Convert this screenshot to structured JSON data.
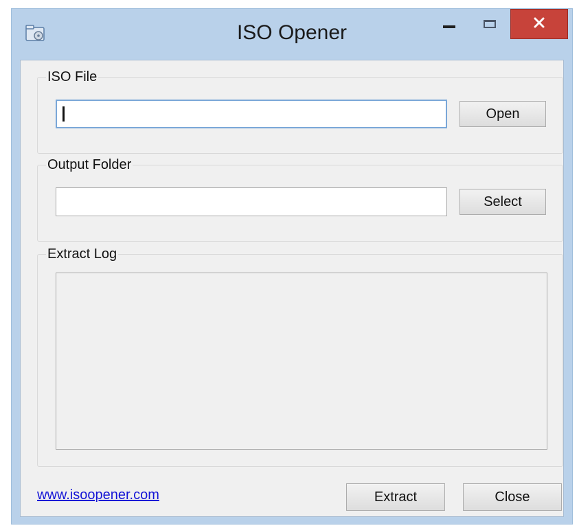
{
  "window": {
    "title": "ISO Opener",
    "close_color": "#c7433a"
  },
  "title_icons": {
    "app": "folder-disc-icon",
    "minimize": "minimize-icon",
    "maximize": "maximize-icon",
    "close": "close-icon"
  },
  "iso_file": {
    "label": "ISO File",
    "value": "",
    "button_label": "Open"
  },
  "output_folder": {
    "label": "Output Folder",
    "value": "",
    "button_label": "Select"
  },
  "extract_log": {
    "label": "Extract Log",
    "content": ""
  },
  "footer": {
    "link_text": "www.isoopener.com",
    "extract_label": "Extract",
    "close_label": "Close"
  }
}
